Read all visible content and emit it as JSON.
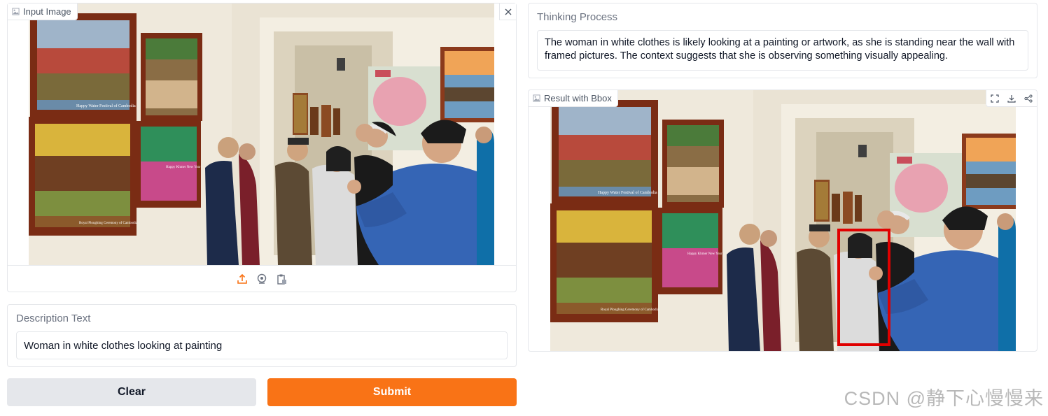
{
  "input_image": {
    "label": "Input Image",
    "painting_caption": "Happy Water Festival of Cambodia",
    "painting_caption_2": "Happy Khmer New Year",
    "painting_caption_3": "Royal Ploughing Ceremony of Cambodia"
  },
  "description": {
    "label": "Description Text",
    "value": "Woman in white clothes looking at painting"
  },
  "buttons": {
    "clear_label": "Clear",
    "submit_label": "Submit"
  },
  "thinking": {
    "label": "Thinking Process",
    "text": "The woman in white clothes is likely looking at a painting or artwork, as she is standing near the wall with framed pictures. The context suggests that she is observing something visually appealing."
  },
  "result": {
    "label": "Result with Bbox"
  },
  "watermark": "CSDN @静下心慢慢来",
  "colors": {
    "accent": "#f97316",
    "bbox": "#e00000"
  },
  "icons": {
    "close": "close-icon",
    "upload": "upload-icon",
    "webcam": "webcam-icon",
    "clipboard": "clipboard-icon",
    "fullscreen": "fullscreen-icon",
    "download": "download-icon",
    "share": "share-icon"
  }
}
